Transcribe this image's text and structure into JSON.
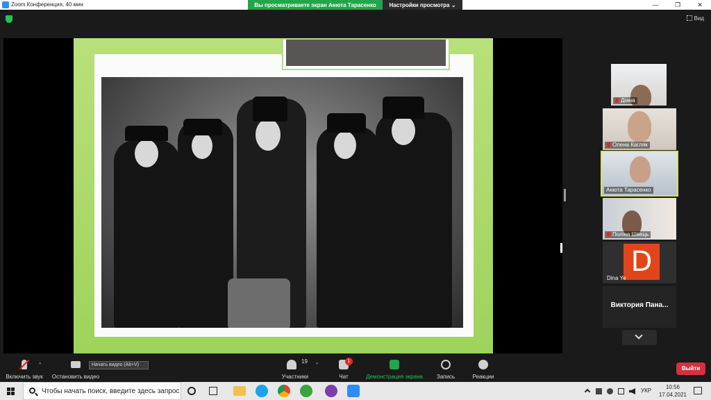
{
  "window": {
    "title": "Zoom Конференция, 40 мин",
    "minimize": "—",
    "maximize": "❐",
    "close": "✕"
  },
  "share_banner": {
    "text": "Вы просматриваете экран Анюта Тарасенко",
    "view_options": "Настройки просмотра ⌄"
  },
  "topbar": {
    "view_label": "Вид"
  },
  "participants": [
    {
      "name": "Діана",
      "muted": true
    },
    {
      "name": "Олена Кагляк",
      "muted": true
    },
    {
      "name": "Анюта Тарасенко",
      "muted": false,
      "active": true
    },
    {
      "name": "Поліна Швець",
      "muted": true
    },
    {
      "name": "Dina Ye",
      "initial": "D",
      "muted": false
    },
    {
      "name": "Виктория  Пана...",
      "name_only": true
    }
  ],
  "toolbar": {
    "unmute": "Включить звук",
    "stop_video": "Остановить видео",
    "video_tooltip": "Начать видео (Alt+V)",
    "participants": "Участники",
    "participants_count": "19",
    "chat": "Чат",
    "chat_badge": "1",
    "share_screen": "Демонстрация экрана",
    "record": "Запись",
    "reactions": "Реакции",
    "leave": "Выйти"
  },
  "taskbar": {
    "search_placeholder": "Чтобы начать поиск, введите здесь запрос",
    "lang": "УКР",
    "time": "10:56",
    "date": "17.04.2021"
  },
  "colors": {
    "accent_green": "#23a54a",
    "leave_red": "#d2323e",
    "active_speaker": "#d7e35a",
    "slide_green": "#9ed35c"
  }
}
